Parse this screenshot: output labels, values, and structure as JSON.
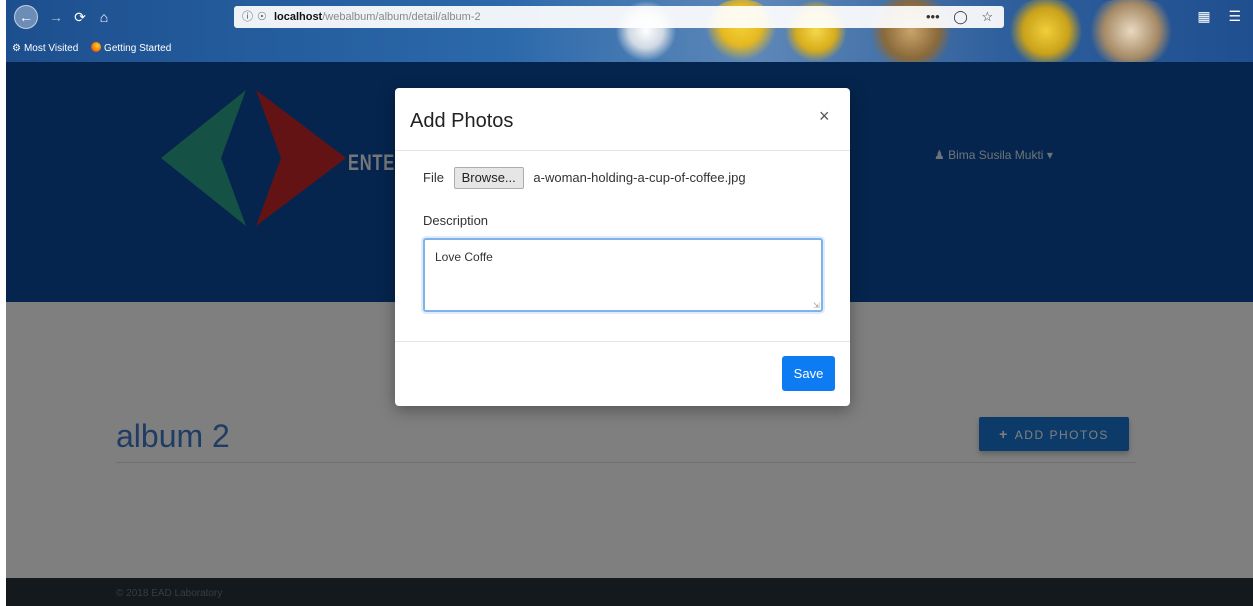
{
  "browser": {
    "url_host": "localhost",
    "url_path": "/webalbum/album/detail/album-2",
    "page_actions": "•••",
    "bookmarks": [
      {
        "label": "Most Visited",
        "icon": "gear-icon"
      },
      {
        "label": "Getting Started",
        "icon": "firefox-icon"
      }
    ]
  },
  "header": {
    "brand": "ENTER",
    "user_name": "Bima Susila Mukti",
    "user_caret": "▾"
  },
  "main": {
    "album_title": "album 2",
    "add_photos_label": "ADD PHOTOS"
  },
  "footer": {
    "text": "© 2018 EAD Laboratory"
  },
  "modal": {
    "title": "Add Photos",
    "close_symbol": "×",
    "file_label": "File",
    "browse_label": "Browse...",
    "file_name": "a-woman-holding-a-cup-of-coffee.jpg",
    "description_label": "Description",
    "description_value": "Love Coffe",
    "save_label": "Save"
  },
  "colors": {
    "hero_blue": "#0a4a9c",
    "accent_blue": "#1976d2",
    "save_blue": "#0d7cf2",
    "title_blue": "#3f79c8",
    "footer_dark": "#263238"
  }
}
